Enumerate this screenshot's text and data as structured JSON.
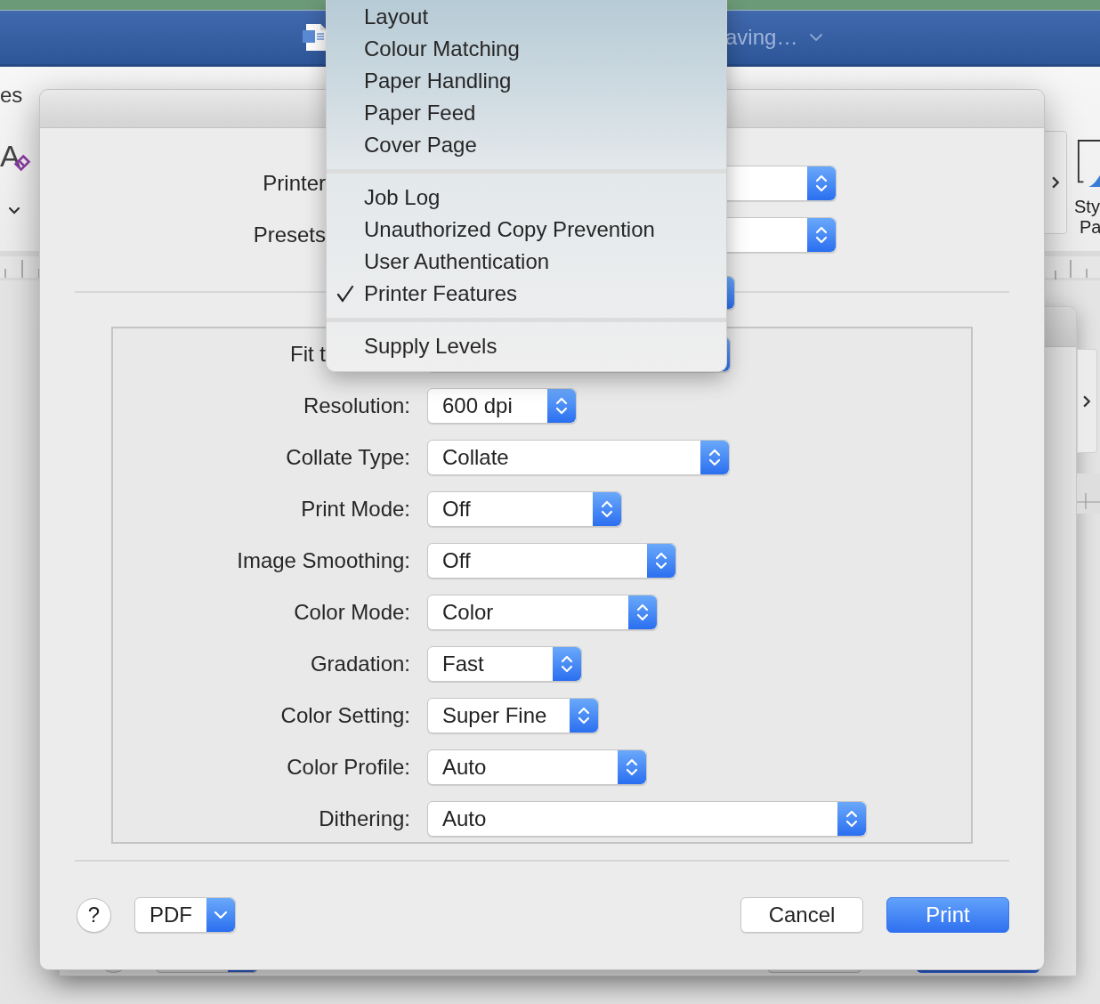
{
  "background_window": {
    "title": "aving…",
    "ribbon_tab": "es",
    "format_glyph": "A",
    "styles_pane_label": [
      "Sty",
      "Pa"
    ]
  },
  "print_dialog": {
    "printer": {
      "label": "Printer"
    },
    "presets": {
      "label": "Presets"
    },
    "options": [
      {
        "label": "Fit t"
      },
      {
        "label": "Resolution:",
        "value": "600 dpi"
      },
      {
        "label": "Collate Type:",
        "value": "Collate"
      },
      {
        "label": "Print Mode:",
        "value": "Off"
      },
      {
        "label": "Image Smoothing:",
        "value": "Off"
      },
      {
        "label": "Color Mode:",
        "value": "Color"
      },
      {
        "label": "Gradation:",
        "value": "Fast"
      },
      {
        "label": "Color Setting:",
        "value": "Super Fine"
      },
      {
        "label": "Color Profile:",
        "value": "Auto"
      },
      {
        "label": "Dithering:",
        "value": "Auto"
      }
    ],
    "help_button": "?",
    "pdf_button": "PDF",
    "buttons": [
      {
        "label": "Cancel",
        "kind": "normal"
      },
      {
        "label": "Print",
        "kind": "default"
      }
    ]
  },
  "panel_menu": {
    "sections": [
      {
        "items": [
          {
            "label": "Layout",
            "checked": false
          },
          {
            "label": "Colour Matching",
            "checked": false
          },
          {
            "label": "Paper Handling",
            "checked": false
          },
          {
            "label": "Paper Feed",
            "checked": false
          },
          {
            "label": "Cover Page",
            "checked": false
          }
        ]
      },
      {
        "items": [
          {
            "label": "Job Log",
            "checked": false
          },
          {
            "label": "Unauthorized Copy Prevention",
            "checked": false
          },
          {
            "label": "User Authentication",
            "checked": false
          },
          {
            "label": "Printer Features",
            "checked": true
          }
        ]
      },
      {
        "items": [
          {
            "label": "Supply Levels",
            "checked": false
          }
        ]
      }
    ]
  }
}
